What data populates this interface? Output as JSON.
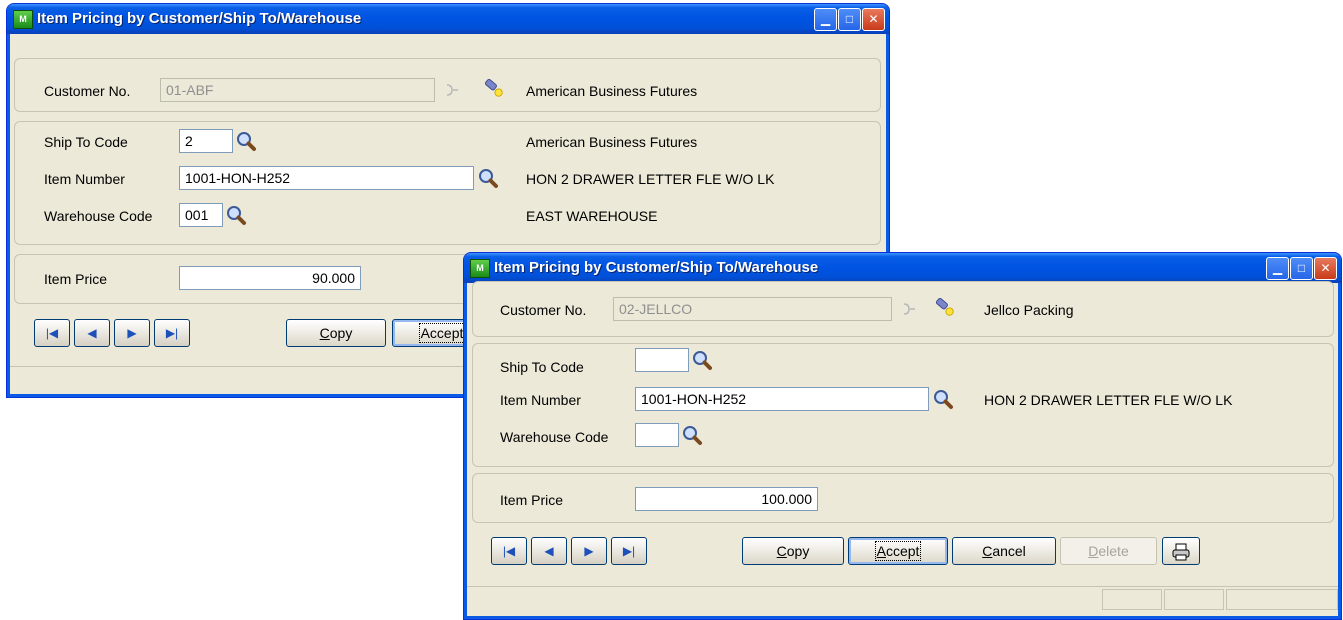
{
  "colors": {
    "titlebar": "#0054e3",
    "window_bg": "#ece9d8",
    "close_button": "#c83a1a"
  },
  "window1": {
    "title": "Item Pricing by Customer/Ship To/Warehouse",
    "icon_label": "M",
    "customer_no_label": "Customer No.",
    "customer_no_value": "01-ABF",
    "customer_name": "American Business Futures",
    "ship_to_label": "Ship To Code",
    "ship_to_value": "2",
    "ship_to_name": "American Business Futures",
    "item_number_label": "Item Number",
    "item_number_value": "1001-HON-H252",
    "item_description": "HON 2 DRAWER LETTER FLE W/O LK",
    "warehouse_label": "Warehouse Code",
    "warehouse_value": "001",
    "warehouse_name": "EAST WAREHOUSE",
    "item_price_label": "Item Price",
    "item_price_value": "90.000",
    "copy_prefix": "C",
    "copy_rest": "opy",
    "accept_label": "Accept"
  },
  "window2": {
    "title": "Item Pricing by Customer/Ship To/Warehouse",
    "icon_label": "M",
    "customer_no_label": "Customer No.",
    "customer_no_value": "02-JELLCO",
    "customer_name": "Jellco Packing",
    "ship_to_label": "Ship To Code",
    "ship_to_value": "",
    "item_number_label": "Item Number",
    "item_number_value": "1001-HON-H252",
    "item_description": "HON 2 DRAWER LETTER FLE W/O LK",
    "warehouse_label": "Warehouse Code",
    "warehouse_value": "",
    "item_price_label": "Item Price",
    "item_price_value": "100.000",
    "copy_prefix": "C",
    "copy_rest": "opy",
    "accept_prefix": "A",
    "accept_rest": "ccept",
    "cancel_prefix": "C",
    "cancel_rest": "ancel",
    "delete_prefix": "D",
    "delete_rest": "elete"
  },
  "icons": {
    "lookup": "magnifier-icon",
    "flashlight": "flashlight-icon",
    "first": "first-record-icon",
    "prev": "previous-record-icon",
    "next": "next-record-icon",
    "last": "last-record-icon",
    "print": "printer-icon"
  }
}
